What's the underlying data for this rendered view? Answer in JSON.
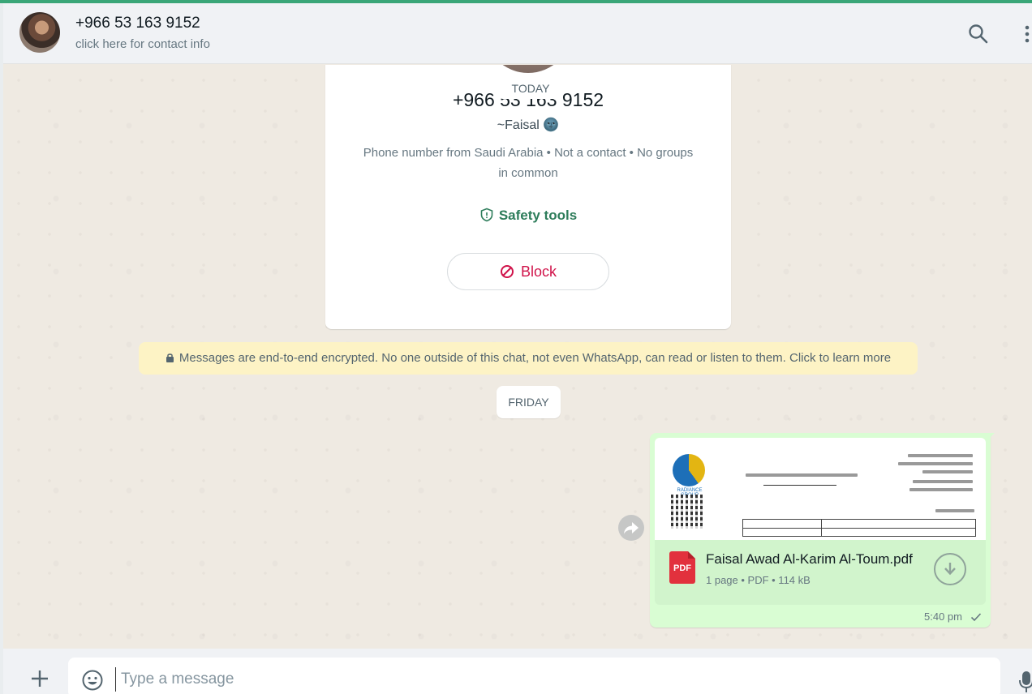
{
  "header": {
    "contact_name": "+966 53 163 9152",
    "contact_subtitle": "click here for contact info"
  },
  "info_card": {
    "date_badge": "TODAY",
    "phone": "+966 53 163 9152",
    "alias": "~Faisal 🌚",
    "description": "Phone number from Saudi Arabia • Not a contact • No groups in common",
    "safety_label": "Safety tools",
    "block_label": "Block"
  },
  "encryption_notice": "Messages are end-to-end encrypted. No one outside of this chat, not even WhatsApp, can read or listen to them. Click to learn more",
  "date_divider": "FRIDAY",
  "message": {
    "preview_badge": "PDF",
    "file_name": "Faisal Awad Al-Karim Al-Toum.pdf",
    "file_meta": "1 page • PDF • 114 kB",
    "time": "5:40 pm",
    "doc_logo_text": "RADIANCE GROUP"
  },
  "composer": {
    "placeholder": "Type a message"
  },
  "colors": {
    "accent": "#00a884",
    "block_red": "#d0134a",
    "outgoing_bubble": "#d9fdd3",
    "notice_bg": "#fdf3c5"
  }
}
